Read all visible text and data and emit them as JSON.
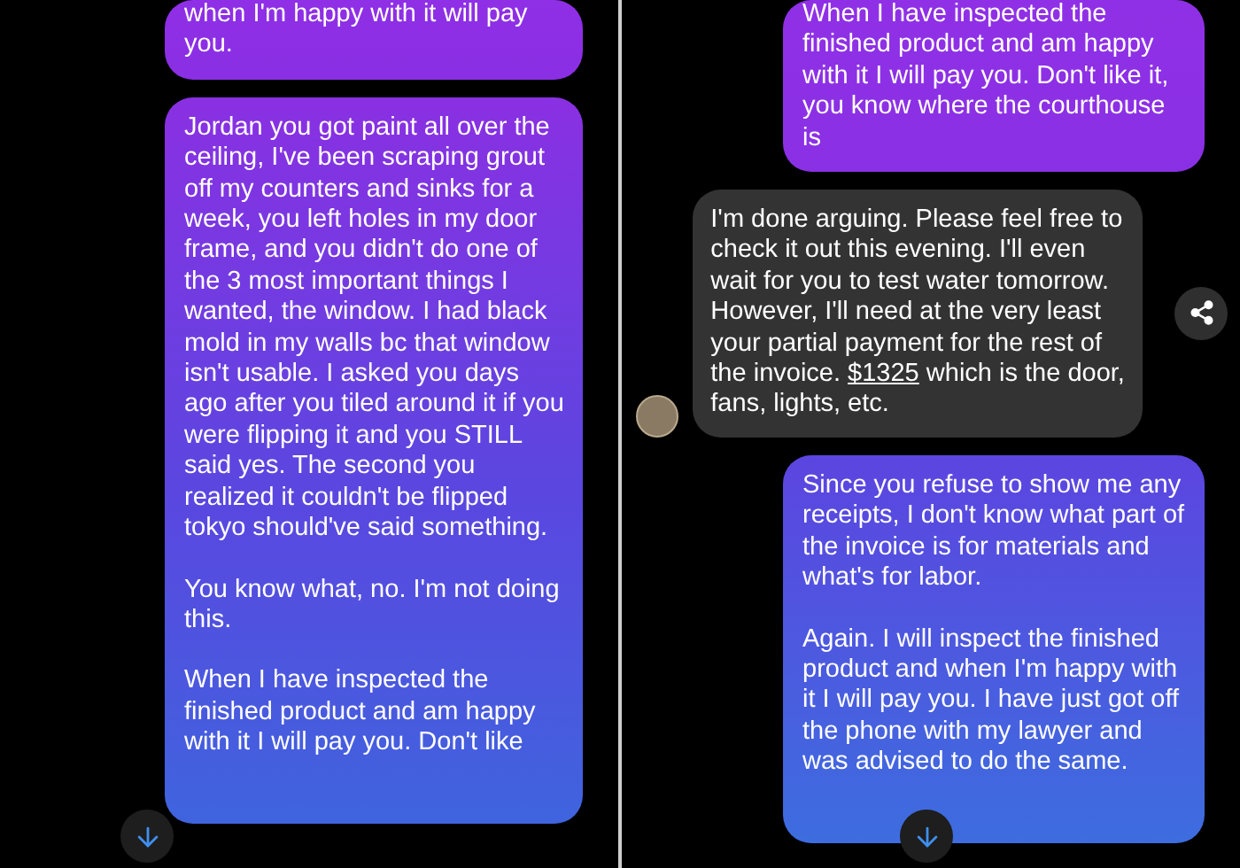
{
  "panels": [
    {
      "messages": [
        {
          "kind": "sent",
          "paragraphs": [
            "when I'm happy with it will pay you."
          ]
        },
        {
          "kind": "sent",
          "paragraphs": [
            "Jordan you got paint all over the ceiling, I've been scraping grout off my counters and sinks for a week, you left holes in my door frame, and you didn't do one of the 3 most important things I wanted, the window. I had black mold in my walls bc that window isn't usable. I asked you days ago after you tiled around it if you were flipping it and you STILL said yes. The second you realized it couldn't be flipped tokyo should've said something.",
            "You know what, no. I'm not doing this.",
            "When I have inspected the finished product and am happy with it I will pay you. Don't like"
          ]
        }
      ]
    },
    {
      "messages": [
        {
          "kind": "sent",
          "paragraphs": [
            "When I have inspected the finished product and am happy with it I will pay you. Don't like it, you know where the courthouse is"
          ]
        },
        {
          "kind": "received",
          "text_before": "I'm done arguing. Please feel free to check it out this evening. I'll even wait for you to test water tomorrow. However, I'll need at the very least your partial payment for the rest of the invoice.",
          "link": "$1325",
          "text_after": "which is the door, fans, lights, etc."
        },
        {
          "kind": "sent",
          "paragraphs": [
            "Since you refuse to show me any receipts, I don't know what part of the invoice is for materials and what's for labor.",
            "Again. I will inspect the finished product and when I'm happy with it I will pay you. I have just got off the phone with my lawyer and was advised to do the same."
          ]
        }
      ]
    }
  ]
}
